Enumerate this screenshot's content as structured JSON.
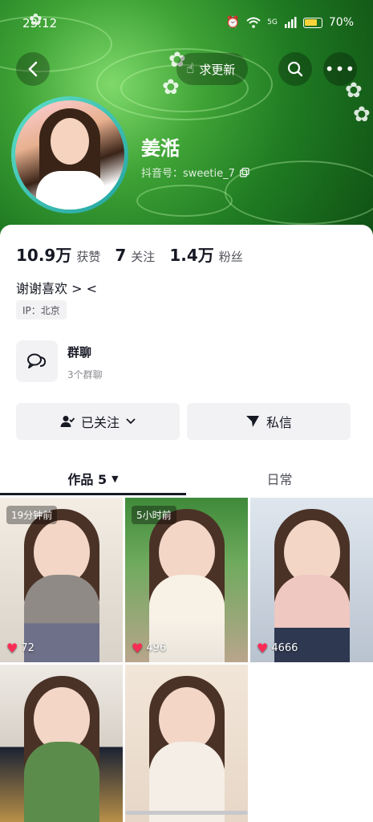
{
  "status": {
    "time": "23:12",
    "network": "5G",
    "battery": "70%"
  },
  "nav": {
    "pill_label": "求更新"
  },
  "profile": {
    "name": "姜湉",
    "douyin_id": "抖音号：sweetie_7"
  },
  "stats": [
    {
      "num": "10.9万",
      "label": "获赞"
    },
    {
      "num": "7",
      "label": "关注"
    },
    {
      "num": "1.4万",
      "label": "粉丝"
    }
  ],
  "bio": "谢谢喜欢 > <",
  "ip": "IP：北京",
  "group": {
    "title": "群聊",
    "sub": "3个群聊"
  },
  "actions": {
    "followed": "已关注",
    "message": "私信"
  },
  "tabs": {
    "works": "作品 5",
    "daily": "日常"
  },
  "posts": [
    {
      "time": "19分钟前",
      "likes": "72"
    },
    {
      "time": "5小时前",
      "likes": "496"
    },
    {
      "time": "",
      "likes": "4666"
    },
    {
      "time": "",
      "likes": ""
    },
    {
      "time": "",
      "likes": ""
    }
  ],
  "colors": {
    "accent_red": "#fe2c55",
    "banner_green": "#2f8f2a",
    "ring_teal": "#22a3a0"
  }
}
